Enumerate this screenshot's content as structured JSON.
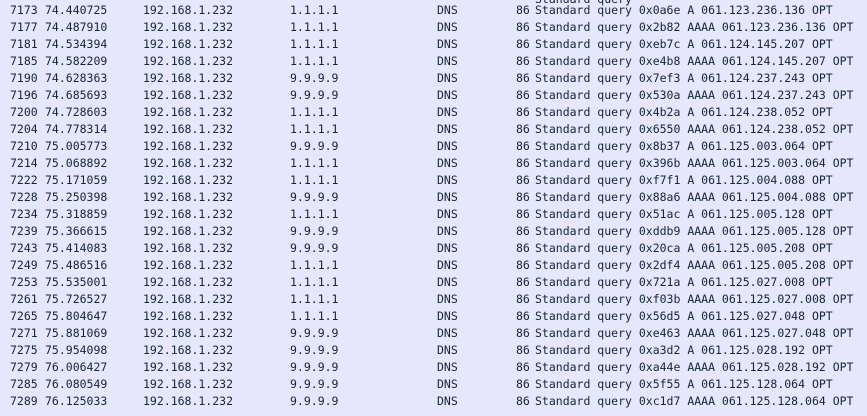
{
  "partial_top_info": "Standard query",
  "rows": [
    {
      "no": "7173",
      "time": "74.440725",
      "src": "192.168.1.232",
      "dst": "1.1.1.1",
      "proto": "DNS",
      "len": "86",
      "info": "Standard query 0x0a6e A 061.123.236.136 OPT"
    },
    {
      "no": "7177",
      "time": "74.487910",
      "src": "192.168.1.232",
      "dst": "1.1.1.1",
      "proto": "DNS",
      "len": "86",
      "info": "Standard query 0x2b82 AAAA 061.123.236.136 OPT"
    },
    {
      "no": "7181",
      "time": "74.534394",
      "src": "192.168.1.232",
      "dst": "1.1.1.1",
      "proto": "DNS",
      "len": "86",
      "info": "Standard query 0xeb7c A 061.124.145.207 OPT"
    },
    {
      "no": "7185",
      "time": "74.582209",
      "src": "192.168.1.232",
      "dst": "1.1.1.1",
      "proto": "DNS",
      "len": "86",
      "info": "Standard query 0xe4b8 AAAA 061.124.145.207 OPT"
    },
    {
      "no": "7190",
      "time": "74.628363",
      "src": "192.168.1.232",
      "dst": "9.9.9.9",
      "proto": "DNS",
      "len": "86",
      "info": "Standard query 0x7ef3 A 061.124.237.243 OPT"
    },
    {
      "no": "7196",
      "time": "74.685693",
      "src": "192.168.1.232",
      "dst": "9.9.9.9",
      "proto": "DNS",
      "len": "86",
      "info": "Standard query 0x530a AAAA 061.124.237.243 OPT"
    },
    {
      "no": "7200",
      "time": "74.728603",
      "src": "192.168.1.232",
      "dst": "1.1.1.1",
      "proto": "DNS",
      "len": "86",
      "info": "Standard query 0x4b2a A 061.124.238.052 OPT"
    },
    {
      "no": "7204",
      "time": "74.778314",
      "src": "192.168.1.232",
      "dst": "1.1.1.1",
      "proto": "DNS",
      "len": "86",
      "info": "Standard query 0x6550 AAAA 061.124.238.052 OPT"
    },
    {
      "no": "7210",
      "time": "75.005773",
      "src": "192.168.1.232",
      "dst": "9.9.9.9",
      "proto": "DNS",
      "len": "86",
      "info": "Standard query 0x8b37 A 061.125.003.064 OPT"
    },
    {
      "no": "7214",
      "time": "75.068892",
      "src": "192.168.1.232",
      "dst": "1.1.1.1",
      "proto": "DNS",
      "len": "86",
      "info": "Standard query 0x396b AAAA 061.125.003.064 OPT"
    },
    {
      "no": "7222",
      "time": "75.171059",
      "src": "192.168.1.232",
      "dst": "1.1.1.1",
      "proto": "DNS",
      "len": "86",
      "info": "Standard query 0xf7f1 A 061.125.004.088 OPT"
    },
    {
      "no": "7228",
      "time": "75.250398",
      "src": "192.168.1.232",
      "dst": "9.9.9.9",
      "proto": "DNS",
      "len": "86",
      "info": "Standard query 0x88a6 AAAA 061.125.004.088 OPT"
    },
    {
      "no": "7234",
      "time": "75.318859",
      "src": "192.168.1.232",
      "dst": "1.1.1.1",
      "proto": "DNS",
      "len": "86",
      "info": "Standard query 0x51ac A 061.125.005.128 OPT"
    },
    {
      "no": "7239",
      "time": "75.366615",
      "src": "192.168.1.232",
      "dst": "9.9.9.9",
      "proto": "DNS",
      "len": "86",
      "info": "Standard query 0xddb9 AAAA 061.125.005.128 OPT"
    },
    {
      "no": "7243",
      "time": "75.414083",
      "src": "192.168.1.232",
      "dst": "9.9.9.9",
      "proto": "DNS",
      "len": "86",
      "info": "Standard query 0x20ca A 061.125.005.208 OPT"
    },
    {
      "no": "7249",
      "time": "75.486516",
      "src": "192.168.1.232",
      "dst": "1.1.1.1",
      "proto": "DNS",
      "len": "86",
      "info": "Standard query 0x2df4 AAAA 061.125.005.208 OPT"
    },
    {
      "no": "7253",
      "time": "75.535001",
      "src": "192.168.1.232",
      "dst": "1.1.1.1",
      "proto": "DNS",
      "len": "86",
      "info": "Standard query 0x721a A 061.125.027.008 OPT"
    },
    {
      "no": "7261",
      "time": "75.726527",
      "src": "192.168.1.232",
      "dst": "1.1.1.1",
      "proto": "DNS",
      "len": "86",
      "info": "Standard query 0xf03b AAAA 061.125.027.008 OPT"
    },
    {
      "no": "7265",
      "time": "75.804647",
      "src": "192.168.1.232",
      "dst": "1.1.1.1",
      "proto": "DNS",
      "len": "86",
      "info": "Standard query 0x56d5 A 061.125.027.048 OPT"
    },
    {
      "no": "7271",
      "time": "75.881069",
      "src": "192.168.1.232",
      "dst": "9.9.9.9",
      "proto": "DNS",
      "len": "86",
      "info": "Standard query 0xe463 AAAA 061.125.027.048 OPT"
    },
    {
      "no": "7275",
      "time": "75.954098",
      "src": "192.168.1.232",
      "dst": "9.9.9.9",
      "proto": "DNS",
      "len": "86",
      "info": "Standard query 0xa3d2 A 061.125.028.192 OPT"
    },
    {
      "no": "7279",
      "time": "76.006427",
      "src": "192.168.1.232",
      "dst": "9.9.9.9",
      "proto": "DNS",
      "len": "86",
      "info": "Standard query 0xa44e AAAA 061.125.028.192 OPT"
    },
    {
      "no": "7285",
      "time": "76.080549",
      "src": "192.168.1.232",
      "dst": "9.9.9.9",
      "proto": "DNS",
      "len": "86",
      "info": "Standard query 0x5f55 A 061.125.128.064 OPT"
    },
    {
      "no": "7289",
      "time": "76.125033",
      "src": "192.168.1.232",
      "dst": "9.9.9.9",
      "proto": "DNS",
      "len": "86",
      "info": "Standard query 0xc1d7 AAAA 061.125.128.064 OPT"
    }
  ]
}
